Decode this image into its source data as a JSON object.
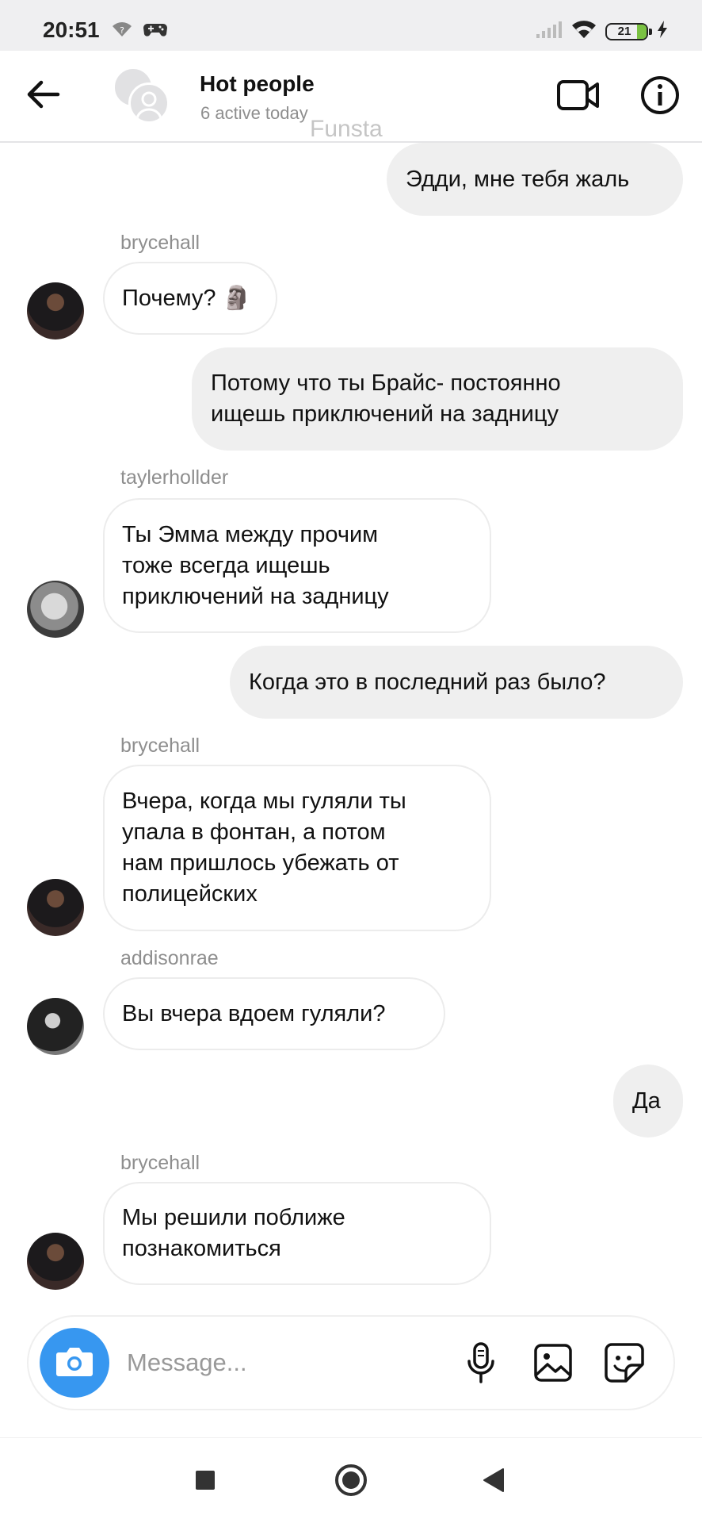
{
  "status_bar": {
    "time": "20:51",
    "battery": "21"
  },
  "header": {
    "title": "Hot people",
    "subtitle": "6 active today",
    "watermark": "Funsta",
    "icons": [
      "arrow-left-icon",
      "group-avatar",
      "video-camera-icon",
      "info-icon"
    ]
  },
  "messages": [
    {
      "type": "sent",
      "text": "Эдди, мне тебя жаль"
    },
    {
      "type": "received",
      "sender": "brycehall",
      "text": "Почему? 🗿"
    },
    {
      "type": "sent",
      "text": "Потому что ты Брайс- постоянно\nищешь приключений на задницу"
    },
    {
      "type": "received",
      "sender": "taylerhollder",
      "text": "Ты Эмма между прочим\nтоже всегда ищешь\nприключений на задницу"
    },
    {
      "type": "sent",
      "text": "Когда это в последний раз было?"
    },
    {
      "type": "received",
      "sender": "brycehall",
      "text": "Вчера, когда мы гуляли ты\nупала в фонтан, а потом\nнам пришлось убежать от\nполицейских"
    },
    {
      "type": "received",
      "sender": "addisonrae",
      "text": "Вы вчера вдоем гуляли?"
    },
    {
      "type": "sent",
      "text": "Да"
    },
    {
      "type": "received",
      "sender": "brycehall",
      "text": "Мы решили поближе\nпознакомиться"
    }
  ],
  "composer": {
    "placeholder": "Message...",
    "icons": [
      "camera-icon",
      "microphone-icon",
      "gallery-icon",
      "sticker-icon"
    ]
  },
  "colors": {
    "accent": "#3797f0",
    "sent_bubble": "#efefef",
    "received_border": "#ececec",
    "secondary_text": "#8e8e8e"
  }
}
